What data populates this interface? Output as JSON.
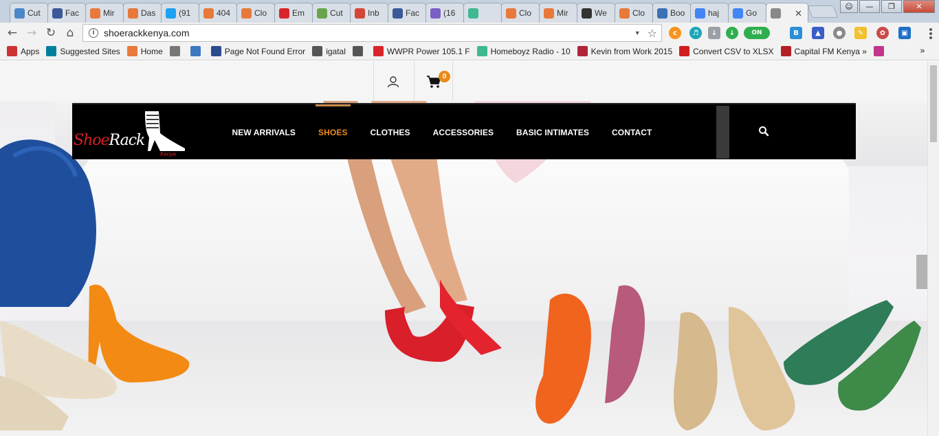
{
  "browser": {
    "tabs": [
      {
        "label": "Cut",
        "icon": "chrome-icon",
        "color": "#4a88c7"
      },
      {
        "label": "Fac",
        "icon": "facebook-icon",
        "color": "#3b5998"
      },
      {
        "label": "Mir",
        "icon": "orange-square-icon",
        "color": "#e8793a"
      },
      {
        "label": "Das",
        "icon": "joomla-icon",
        "color": "#e8793a"
      },
      {
        "label": "(91",
        "icon": "twitter-icon",
        "color": "#1da1f2"
      },
      {
        "label": "404",
        "icon": "orange-square-icon",
        "color": "#e8793a"
      },
      {
        "label": "Clo",
        "icon": "orange-square-icon",
        "color": "#e8793a"
      },
      {
        "label": "Em",
        "icon": "zoho-icon",
        "color": "#d9252a"
      },
      {
        "label": "Cut",
        "icon": "cut-icon",
        "color": "#69a44c"
      },
      {
        "label": "Inb",
        "icon": "gmail-icon",
        "color": "#d44638"
      },
      {
        "label": "Fac",
        "icon": "facebook-icon",
        "color": "#3b5998"
      },
      {
        "label": "(16",
        "icon": "mail-icon",
        "color": "#7a5fc6"
      },
      {
        "label": "",
        "icon": "slack-icon",
        "color": "#3eb991"
      },
      {
        "label": "Clo",
        "icon": "orange-square-icon",
        "color": "#e8793a"
      },
      {
        "label": "Mir",
        "icon": "orange-square-icon",
        "color": "#e8793a"
      },
      {
        "label": "We",
        "icon": "jh-icon",
        "color": "#333333"
      },
      {
        "label": "Clo",
        "icon": "orange-square-icon",
        "color": "#e8793a"
      },
      {
        "label": "Boo",
        "icon": "bootstrap-icon",
        "color": "#3b72b5"
      },
      {
        "label": "haj",
        "icon": "google-icon",
        "color": "#4285f4"
      },
      {
        "label": "Go",
        "icon": "google-icon",
        "color": "#4285f4"
      },
      {
        "label": "",
        "icon": "shoerack-tab-icon",
        "color": "#888888",
        "active": true
      }
    ],
    "url": "shoerackkenya.com",
    "extensions_on_label": "ON",
    "bookmarks": [
      {
        "label": "Apps",
        "icon": "apps-grid-icon",
        "color": "#c33"
      },
      {
        "label": "Suggested Sites",
        "icon": "bing-icon",
        "color": "#00809d"
      },
      {
        "label": "Home",
        "icon": "joomla-icon",
        "color": "#e8793a"
      },
      {
        "label": "",
        "icon": "shoerack-bookmark-icon",
        "color": "#777777"
      },
      {
        "label": "",
        "icon": "m-circle-icon",
        "color": "#3b78c0"
      },
      {
        "label": "Page Not Found Error",
        "icon": "p-icon",
        "color": "#2a4b8d"
      },
      {
        "label": "igatal",
        "icon": "olx-icon",
        "color": "#555555"
      },
      {
        "label": "",
        "icon": "olx-icon",
        "color": "#555555"
      },
      {
        "label": "WWPR Power 105.1 F",
        "icon": "power-radio-icon",
        "color": "#d9252a"
      },
      {
        "label": "Homeboyz Radio - 10",
        "icon": "homeboyz-icon",
        "color": "#3eb991"
      },
      {
        "label": "Kevin from Work 2015",
        "icon": "ez-icon",
        "color": "#b0243a"
      },
      {
        "label": "Convert CSV to XLSX",
        "icon": "convert-icon",
        "color": "#d01d1d"
      },
      {
        "label": "Capital FM Kenya »",
        "icon": "capital-fm-icon",
        "color": "#b32024"
      },
      {
        "label": "",
        "icon": "instagram-icon",
        "color": "#c1358c"
      }
    ]
  },
  "site": {
    "logo_text_main": "Shoe",
    "logo_text_accent": "Rack",
    "logo_sub": "Kenya",
    "cart_count": "0",
    "nav": [
      {
        "label": "NEW ARRIVALS",
        "active": false
      },
      {
        "label": "SHOES",
        "active": true
      },
      {
        "label": "CLOTHES",
        "active": false
      },
      {
        "label": "ACCESSORIES",
        "active": false
      },
      {
        "label": "BASIC INTIMATES",
        "active": false
      },
      {
        "label": "CONTACT",
        "active": false
      }
    ],
    "accent_color": "#e98a1b"
  }
}
